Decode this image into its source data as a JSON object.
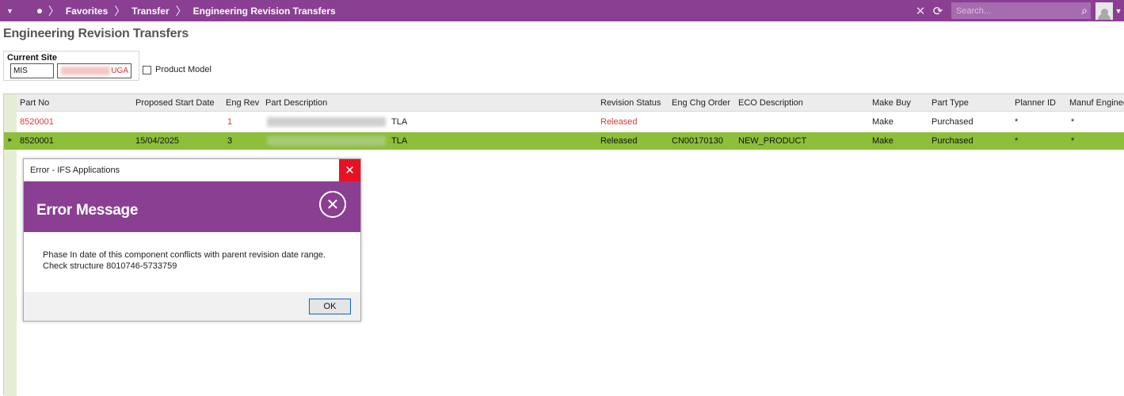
{
  "breadcrumb": {
    "items": [
      "Favorites",
      "Transfer",
      "Engineering Revision Transfers"
    ]
  },
  "search": {
    "placeholder": "Search..."
  },
  "page": {
    "title": "Engineering Revision Transfers"
  },
  "site": {
    "label": "Current Site",
    "code": "MIS",
    "name_suffix": "UGA",
    "product_model_label": "Product Model",
    "product_model_checked": false
  },
  "table": {
    "columns": [
      "Part No",
      "Proposed Start Date",
      "Eng Rev",
      "Part Description",
      "Revision Status",
      "Eng Chg Order",
      "ECO Description",
      "Make Buy",
      "Part Type",
      "Planner ID",
      "Manuf Enginee"
    ],
    "rows": [
      {
        "part_no": "8520001",
        "start_date": "",
        "eng_rev": "1",
        "desc_suffix": "TLA",
        "status": "Released",
        "eco": "",
        "eco_desc": "",
        "make_buy": "Make",
        "part_type": "Purchased",
        "planner": "*",
        "manuf": "*"
      },
      {
        "part_no": "8520001",
        "start_date": "15/04/2025",
        "eng_rev": "3",
        "desc_suffix": "TLA",
        "status": "Released",
        "eco": "CN00170130",
        "eco_desc": "NEW_PRODUCT",
        "make_buy": "Make",
        "part_type": "Purchased",
        "planner": "*",
        "manuf": "*"
      }
    ]
  },
  "dialog": {
    "window_title": "Error - IFS Applications",
    "heading": "Error Message",
    "message": "Phase In date of this component conflicts with parent revision date range. Check structure 8010746-5733759",
    "ok_label": "OK"
  },
  "colors": {
    "brand_purple": "#8a3f93",
    "selected_row": "#8dbf3a",
    "error_red": "#d73a3a",
    "close_red": "#e81123"
  }
}
